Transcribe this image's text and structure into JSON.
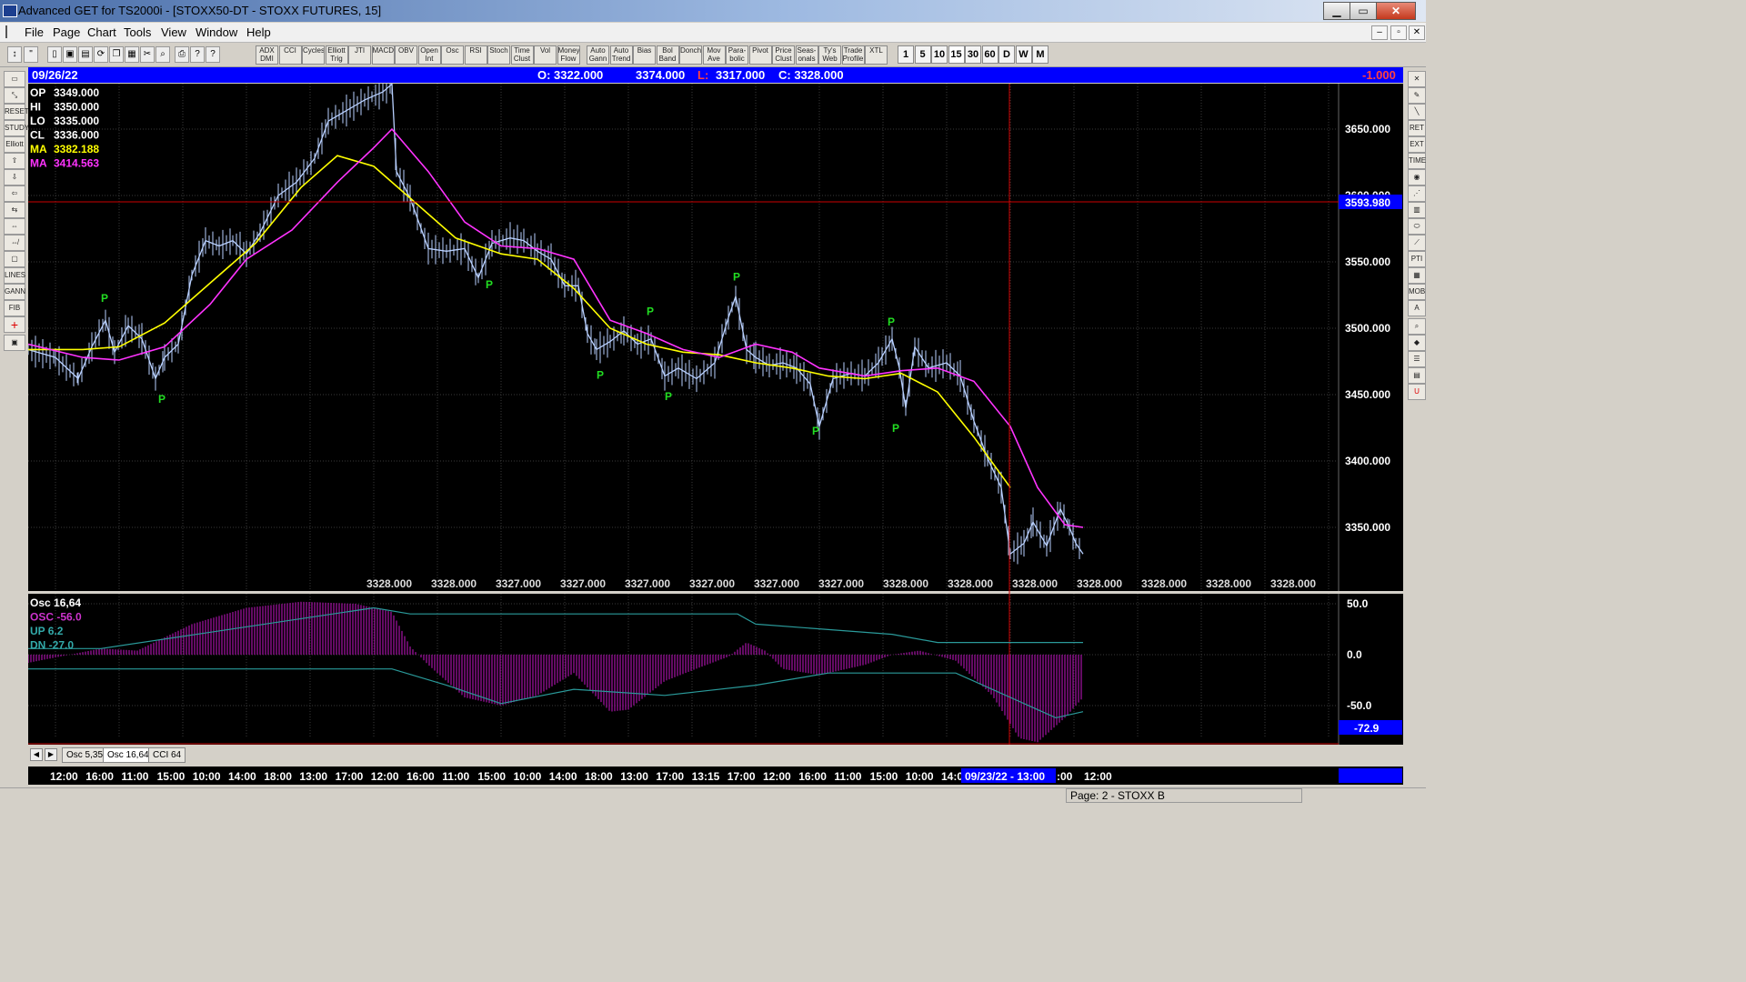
{
  "window": {
    "title": "Advanced GET for TS2000i - [STOXX50-DT - STOXX FUTURES, 15]",
    "min": "▁",
    "max": "▭",
    "close": "✕"
  },
  "menu": [
    "File",
    "Page",
    "Chart",
    "Tools",
    "View",
    "Window",
    "Help"
  ],
  "toolbar": {
    "studies": [
      "ADX DMI",
      "CCI",
      "Cycles",
      "Elliott Trig",
      "JTI",
      "MACD",
      "OBV",
      "Open Int",
      "Osc",
      "RSI",
      "Stoch",
      "Time Clust",
      "Vol",
      "Money Flow"
    ],
    "tools": [
      "Auto Gann",
      "Auto Trend",
      "Bias",
      "Bol Band",
      "Donch",
      "Mov Ave",
      "Para-bolic",
      "Pivot",
      "Price Clust",
      "Seas-onals",
      "Ty's Web",
      "Trade Profile",
      "XTL"
    ],
    "periods": [
      "1",
      "5",
      "10",
      "15",
      "30",
      "60",
      "D",
      "W",
      "M"
    ]
  },
  "infobar": {
    "date": "09/26/22",
    "open": "O: 3322.000",
    "high": "3374.000",
    "low_label": "L:",
    "low": "3317.000",
    "close": "C: 3328.000",
    "change": "-1.000"
  },
  "price_panel": {
    "legend": [
      {
        "label": "OP",
        "value": "3349.000",
        "color": "#ffffff"
      },
      {
        "label": "HI",
        "value": "3350.000",
        "color": "#ffffff"
      },
      {
        "label": "LO",
        "value": "3335.000",
        "color": "#ffffff"
      },
      {
        "label": "CL",
        "value": "3336.000",
        "color": "#ffffff"
      },
      {
        "label": "MA",
        "value": "3382.188",
        "color": "#ffff00"
      },
      {
        "label": "MA",
        "value": "3414.563",
        "color": "#ff33ff"
      }
    ],
    "axis_ticks": [
      "3650.000",
      "3600.000",
      "3550.000",
      "3500.000",
      "3450.000",
      "3400.000",
      "3350.000"
    ],
    "cursor_price": "3593.980",
    "bottom_values": [
      "3328.000",
      "3328.000",
      "3327.000",
      "3327.000",
      "3327.000",
      "3327.000",
      "3327.000",
      "3327.000",
      "3328.000",
      "3328.000",
      "3328.000",
      "3328.000",
      "3328.000",
      "3328.000",
      "3328.000"
    ],
    "pivot_marker": "P"
  },
  "osc_panel": {
    "legend": [
      {
        "label": "Osc 16,64",
        "color": "#ffffff"
      },
      {
        "label": "OSC -56.0",
        "color": "#cc33cc"
      },
      {
        "label": "UP   6.2",
        "color": "#33aaaa"
      },
      {
        "label": "DN   -27.0",
        "color": "#33aaaa"
      }
    ],
    "axis_ticks": [
      "50.0",
      "0.0",
      "-50.0"
    ],
    "current": "-72.9"
  },
  "tabs": [
    "Osc 5,35",
    "Osc 16,64",
    "CCI 64"
  ],
  "time_axis": [
    "12:00",
    "16:00",
    "11:00",
    "15:00",
    "10:00",
    "14:00",
    "18:00",
    "13:00",
    "17:00",
    "12:00",
    "16:00",
    "11:00",
    "15:00",
    "10:00",
    "14:00",
    "18:00",
    "13:00",
    "17:00",
    "13:15",
    "17:00",
    "12:00",
    "16:00",
    "11:00",
    "15:00",
    "10:00",
    "14:0"
  ],
  "time_axis_tail": [
    ":00",
    "12:00"
  ],
  "cursor_time": "09/23/22 - 13:00",
  "status": "Page: 2 - STOXX B",
  "colors": {
    "accent": "#0000ff",
    "ma_fast": "#ffff00",
    "ma_slow": "#ff33ff",
    "bars": "#b8d0ff",
    "pivot": "#22dd22",
    "osc_hist": "#991199",
    "cursor": "#cc0000"
  }
}
